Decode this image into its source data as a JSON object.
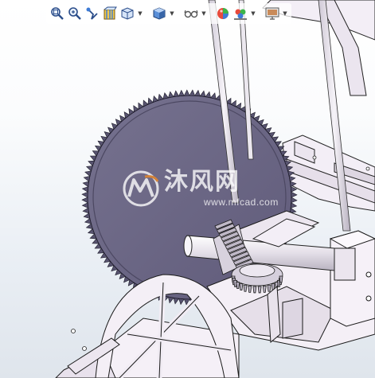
{
  "viewport": {
    "background_top": "#ffffff",
    "background_bottom": "#dfe5ec",
    "part_colors": {
      "blade": "#6c6886",
      "frame_fill": "#f4eef6",
      "frame_edge": "#222222",
      "shaft": "#e6e2ea",
      "gear": "#d9d4de"
    }
  },
  "heads_up_toolbar": {
    "tools": [
      {
        "name": "zoom-to-fit",
        "icon": "magnifier-fit-icon"
      },
      {
        "name": "zoom-to-area",
        "icon": "magnifier-area-icon"
      },
      {
        "name": "previous-view",
        "icon": "previous-view-icon"
      },
      {
        "name": "section-view",
        "icon": "section-view-icon"
      },
      {
        "name": "view-orientation",
        "icon": "cube-orientation-icon",
        "has_dropdown": true
      },
      {
        "name": "display-style",
        "icon": "shaded-cube-icon",
        "has_dropdown": true
      },
      {
        "name": "hide-show-items",
        "icon": "glasses-icon",
        "has_dropdown": true
      },
      {
        "name": "edit-appearance",
        "icon": "color-ball-icon"
      },
      {
        "name": "apply-scene",
        "icon": "scene-icon",
        "has_dropdown": true
      },
      {
        "name": "view-settings",
        "icon": "monitor-settings-icon",
        "has_dropdown": true
      }
    ],
    "dropdown_glyph": "▼"
  },
  "watermark": {
    "brand_cn": "沐风网",
    "url": "www.mfcad.com",
    "logo_letters": "MF"
  }
}
